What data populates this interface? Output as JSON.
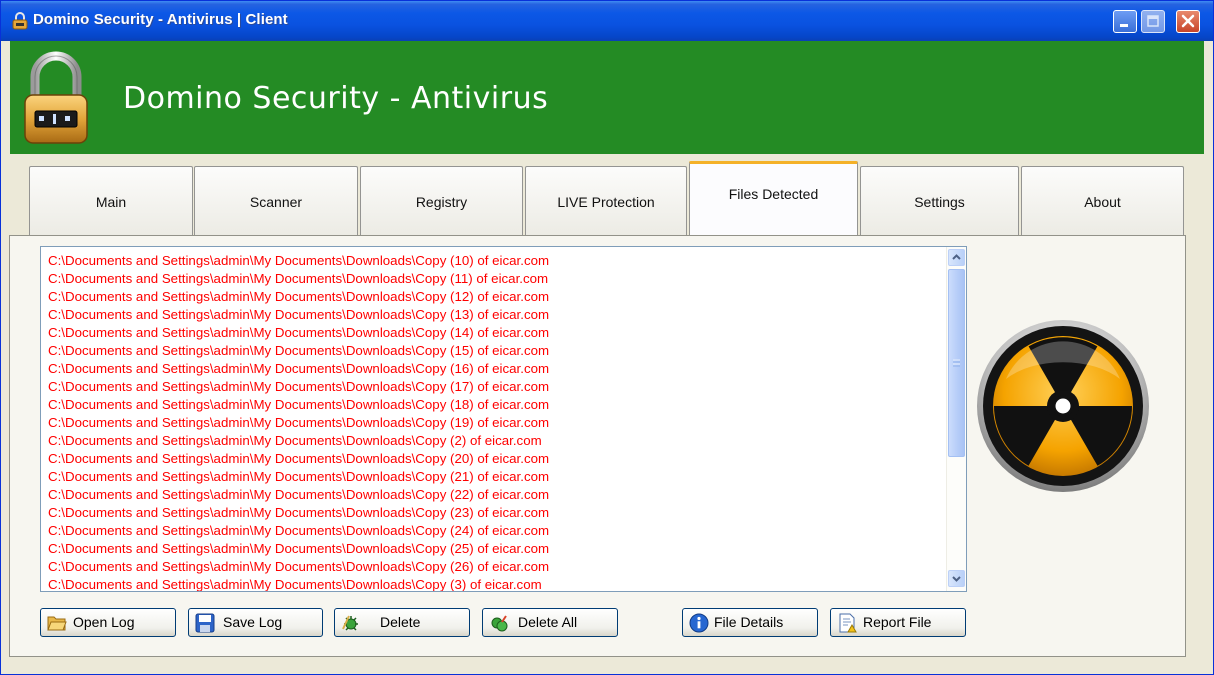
{
  "window": {
    "title": "Domino Security - Antivirus  |  Client",
    "controls": [
      "minimize-icon",
      "maximize-icon",
      "close-icon"
    ]
  },
  "banner": {
    "title": "Domino Security - Antivirus",
    "logo_icon": "padlock-icon"
  },
  "tabs": [
    {
      "label": "Main",
      "active": false
    },
    {
      "label": "Scanner",
      "active": false
    },
    {
      "label": "Registry",
      "active": false
    },
    {
      "label": "LIVE Protection",
      "active": false
    },
    {
      "label": "Files Detected",
      "active": true
    },
    {
      "label": "Settings",
      "active": false
    },
    {
      "label": "About",
      "active": false
    }
  ],
  "files_detected": {
    "items": [
      "C:\\Documents and Settings\\admin\\My Documents\\Downloads\\Copy (10) of eicar.com",
      "C:\\Documents and Settings\\admin\\My Documents\\Downloads\\Copy (11) of eicar.com",
      "C:\\Documents and Settings\\admin\\My Documents\\Downloads\\Copy (12) of eicar.com",
      "C:\\Documents and Settings\\admin\\My Documents\\Downloads\\Copy (13) of eicar.com",
      "C:\\Documents and Settings\\admin\\My Documents\\Downloads\\Copy (14) of eicar.com",
      "C:\\Documents and Settings\\admin\\My Documents\\Downloads\\Copy (15) of eicar.com",
      "C:\\Documents and Settings\\admin\\My Documents\\Downloads\\Copy (16) of eicar.com",
      "C:\\Documents and Settings\\admin\\My Documents\\Downloads\\Copy (17) of eicar.com",
      "C:\\Documents and Settings\\admin\\My Documents\\Downloads\\Copy (18) of eicar.com",
      "C:\\Documents and Settings\\admin\\My Documents\\Downloads\\Copy (19) of eicar.com",
      "C:\\Documents and Settings\\admin\\My Documents\\Downloads\\Copy (2) of eicar.com",
      "C:\\Documents and Settings\\admin\\My Documents\\Downloads\\Copy (20) of eicar.com",
      "C:\\Documents and Settings\\admin\\My Documents\\Downloads\\Copy (21) of eicar.com",
      "C:\\Documents and Settings\\admin\\My Documents\\Downloads\\Copy (22) of eicar.com",
      "C:\\Documents and Settings\\admin\\My Documents\\Downloads\\Copy (23) of eicar.com",
      "C:\\Documents and Settings\\admin\\My Documents\\Downloads\\Copy (24) of eicar.com",
      "C:\\Documents and Settings\\admin\\My Documents\\Downloads\\Copy (25) of eicar.com",
      "C:\\Documents and Settings\\admin\\My Documents\\Downloads\\Copy (26) of eicar.com",
      "C:\\Documents and Settings\\admin\\My Documents\\Downloads\\Copy (3) of eicar.com"
    ],
    "item_color": "#ff0000"
  },
  "buttons": {
    "open_log": {
      "label": "Open Log",
      "icon": "folder-open-icon"
    },
    "save_log": {
      "label": "Save Log",
      "icon": "floppy-disk-icon"
    },
    "delete": {
      "label": "Delete",
      "icon": "delete-virus-icon"
    },
    "delete_all": {
      "label": "Delete All",
      "icon": "delete-all-icon"
    },
    "file_details": {
      "label": "File Details",
      "icon": "info-icon"
    },
    "report_file": {
      "label": "Report File",
      "icon": "report-document-icon"
    }
  },
  "side_graphic": {
    "icon": "radiation-hazard-icon"
  },
  "colors": {
    "banner_green": "#248b24",
    "titlebar_blue": "#0a52e0",
    "active_tab_accent": "#f4b128",
    "detected_text": "#ff0000"
  }
}
